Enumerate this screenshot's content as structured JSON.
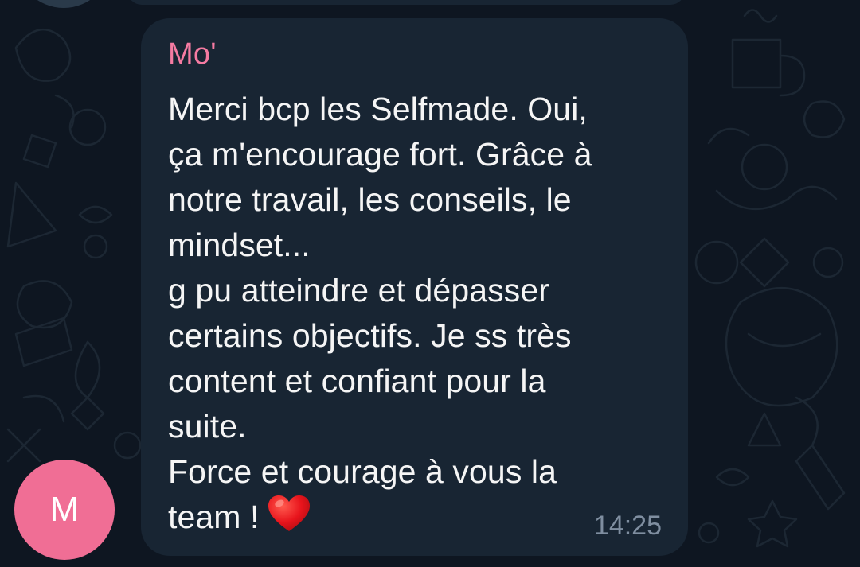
{
  "theme": {
    "background": "#0e1621",
    "bubble": "#182533",
    "sender_color": "#f57ba2",
    "avatar_color": "#f06e95",
    "text_color": "#f5f5f5",
    "time_color": "#7f8ea0"
  },
  "message": {
    "sender": "Mo'",
    "text": "Merci bcp les Selfmade. Oui,\nça m'encourage fort. Grâce à\nnotre travail, les conseils, le\nmindset...\ng pu atteindre et dépasser\ncertains objectifs. Je ss très\ncontent et confiant pour la\nsuite.\nForce et courage à vous la\nteam !",
    "emoji": "red-heart",
    "time": "14:25"
  },
  "avatar": {
    "initial": "M"
  }
}
